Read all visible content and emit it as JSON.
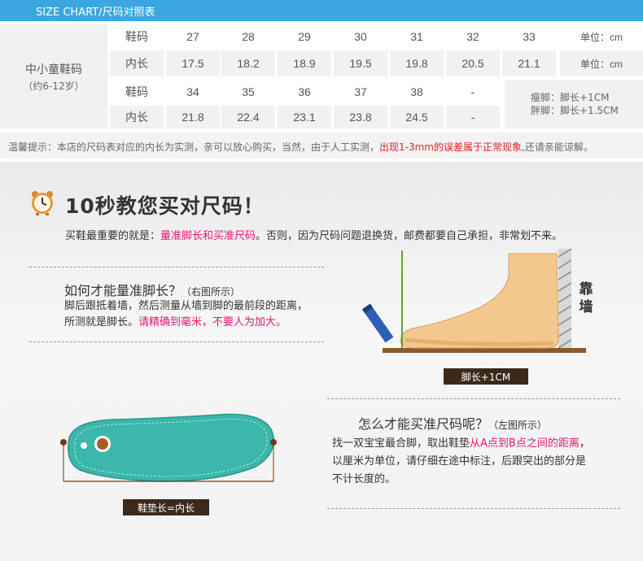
{
  "header": {
    "title": "SIZE CHART/尺码对照表"
  },
  "size_table": {
    "group_label": "中小童鞋码",
    "age_range": "（约6-12岁）",
    "row_labels": {
      "shoe_size": "鞋码",
      "inner_length": "内长"
    },
    "rows": [
      {
        "sizes": [
          "27",
          "28",
          "29",
          "30",
          "31",
          "32",
          "33"
        ],
        "lengths": [
          "17.5",
          "18.2",
          "18.9",
          "19.5",
          "19.8",
          "20.5",
          "21.1"
        ]
      },
      {
        "sizes": [
          "34",
          "35",
          "36",
          "37",
          "38",
          "-"
        ],
        "lengths": [
          "21.8",
          "22.4",
          "23.1",
          "23.8",
          "24.5",
          "-"
        ]
      }
    ],
    "unit_label": "单位：cm",
    "thin_foot": "瘦脚：脚长+1CM",
    "fat_foot": "胖脚：脚长+1.5CM"
  },
  "tip": {
    "prefix": "温馨提示：本店的尺码表对应的内长为实测，亲可以放心购买，当然，由于人工实测，",
    "highlight": "出现1-3mm的误差属于正常现象",
    "suffix": ",还请亲能谅解。"
  },
  "guide": {
    "headline": "10秒教您买对尺码！",
    "intro_prefix": "买鞋最重要的就是：",
    "intro_highlight": "量准脚长和买准尺码",
    "intro_suffix": "。否则，因为尺码问题退换货，邮费都要自己承担，非常划不来。",
    "measure_title": "如何才能量准脚长？",
    "measure_hint": "（右图所示）",
    "measure_line1": "脚后跟抵着墙，然后测量从墙到脚的最前段的距离，",
    "measure_line2_prefix": "所测就是脚长。",
    "measure_line2_highlight": "请精确到毫米，不要人为加大。",
    "wall_label": "靠墙",
    "foot_tag": "脚长+1CM",
    "buy_title": "怎么才能买准尺码呢？",
    "buy_hint": "（左图所示）",
    "buy_line1_prefix": "找一双宝宝最合脚，取出鞋垫",
    "buy_line1_highlight": "从A点到B点之间的距离",
    "buy_line1_suffix": "，",
    "buy_line2": "以厘米为单位，请仔细在途中标注，后跟突出的部分是",
    "buy_line3": "不计长度的。",
    "insole_tag": "鞋垫长=内长"
  },
  "colors": {
    "header_blue": "#3aa7e0",
    "highlight_pink": "#e5186f",
    "tip_red": "#e1222b",
    "insole_teal": "#3cb7ac",
    "tag_brown": "#3b2a1c"
  }
}
